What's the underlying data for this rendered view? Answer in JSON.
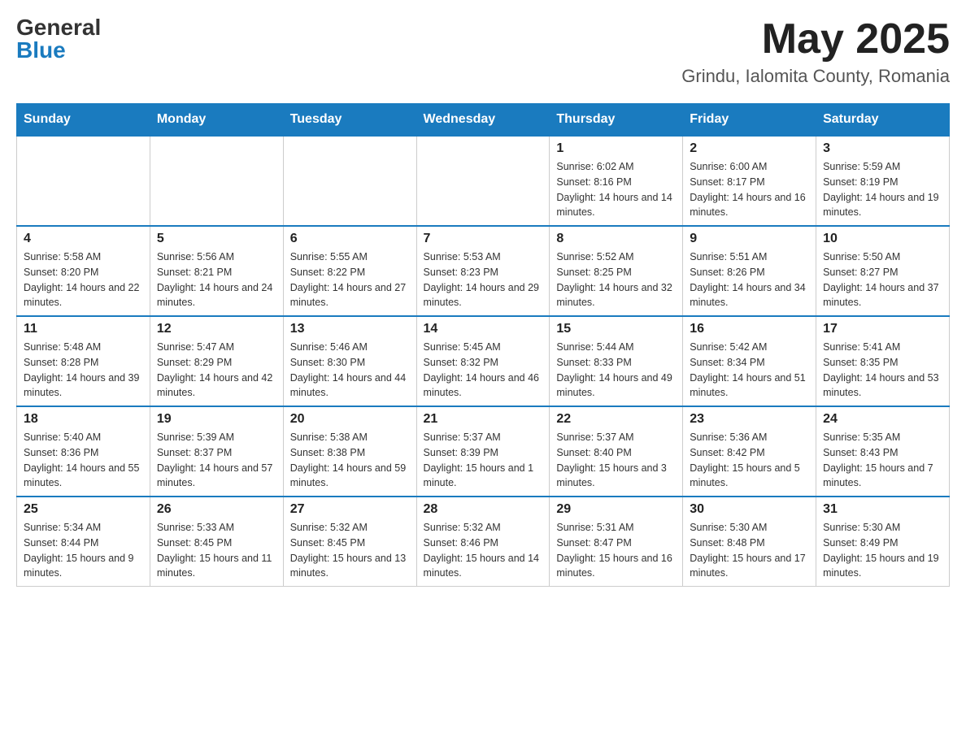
{
  "header": {
    "logo_general": "General",
    "logo_blue": "Blue",
    "month_title": "May 2025",
    "location": "Grindu, Ialomita County, Romania"
  },
  "weekdays": [
    "Sunday",
    "Monday",
    "Tuesday",
    "Wednesday",
    "Thursday",
    "Friday",
    "Saturday"
  ],
  "weeks": [
    [
      {
        "day": "",
        "info": ""
      },
      {
        "day": "",
        "info": ""
      },
      {
        "day": "",
        "info": ""
      },
      {
        "day": "",
        "info": ""
      },
      {
        "day": "1",
        "info": "Sunrise: 6:02 AM\nSunset: 8:16 PM\nDaylight: 14 hours and 14 minutes."
      },
      {
        "day": "2",
        "info": "Sunrise: 6:00 AM\nSunset: 8:17 PM\nDaylight: 14 hours and 16 minutes."
      },
      {
        "day": "3",
        "info": "Sunrise: 5:59 AM\nSunset: 8:19 PM\nDaylight: 14 hours and 19 minutes."
      }
    ],
    [
      {
        "day": "4",
        "info": "Sunrise: 5:58 AM\nSunset: 8:20 PM\nDaylight: 14 hours and 22 minutes."
      },
      {
        "day": "5",
        "info": "Sunrise: 5:56 AM\nSunset: 8:21 PM\nDaylight: 14 hours and 24 minutes."
      },
      {
        "day": "6",
        "info": "Sunrise: 5:55 AM\nSunset: 8:22 PM\nDaylight: 14 hours and 27 minutes."
      },
      {
        "day": "7",
        "info": "Sunrise: 5:53 AM\nSunset: 8:23 PM\nDaylight: 14 hours and 29 minutes."
      },
      {
        "day": "8",
        "info": "Sunrise: 5:52 AM\nSunset: 8:25 PM\nDaylight: 14 hours and 32 minutes."
      },
      {
        "day": "9",
        "info": "Sunrise: 5:51 AM\nSunset: 8:26 PM\nDaylight: 14 hours and 34 minutes."
      },
      {
        "day": "10",
        "info": "Sunrise: 5:50 AM\nSunset: 8:27 PM\nDaylight: 14 hours and 37 minutes."
      }
    ],
    [
      {
        "day": "11",
        "info": "Sunrise: 5:48 AM\nSunset: 8:28 PM\nDaylight: 14 hours and 39 minutes."
      },
      {
        "day": "12",
        "info": "Sunrise: 5:47 AM\nSunset: 8:29 PM\nDaylight: 14 hours and 42 minutes."
      },
      {
        "day": "13",
        "info": "Sunrise: 5:46 AM\nSunset: 8:30 PM\nDaylight: 14 hours and 44 minutes."
      },
      {
        "day": "14",
        "info": "Sunrise: 5:45 AM\nSunset: 8:32 PM\nDaylight: 14 hours and 46 minutes."
      },
      {
        "day": "15",
        "info": "Sunrise: 5:44 AM\nSunset: 8:33 PM\nDaylight: 14 hours and 49 minutes."
      },
      {
        "day": "16",
        "info": "Sunrise: 5:42 AM\nSunset: 8:34 PM\nDaylight: 14 hours and 51 minutes."
      },
      {
        "day": "17",
        "info": "Sunrise: 5:41 AM\nSunset: 8:35 PM\nDaylight: 14 hours and 53 minutes."
      }
    ],
    [
      {
        "day": "18",
        "info": "Sunrise: 5:40 AM\nSunset: 8:36 PM\nDaylight: 14 hours and 55 minutes."
      },
      {
        "day": "19",
        "info": "Sunrise: 5:39 AM\nSunset: 8:37 PM\nDaylight: 14 hours and 57 minutes."
      },
      {
        "day": "20",
        "info": "Sunrise: 5:38 AM\nSunset: 8:38 PM\nDaylight: 14 hours and 59 minutes."
      },
      {
        "day": "21",
        "info": "Sunrise: 5:37 AM\nSunset: 8:39 PM\nDaylight: 15 hours and 1 minute."
      },
      {
        "day": "22",
        "info": "Sunrise: 5:37 AM\nSunset: 8:40 PM\nDaylight: 15 hours and 3 minutes."
      },
      {
        "day": "23",
        "info": "Sunrise: 5:36 AM\nSunset: 8:42 PM\nDaylight: 15 hours and 5 minutes."
      },
      {
        "day": "24",
        "info": "Sunrise: 5:35 AM\nSunset: 8:43 PM\nDaylight: 15 hours and 7 minutes."
      }
    ],
    [
      {
        "day": "25",
        "info": "Sunrise: 5:34 AM\nSunset: 8:44 PM\nDaylight: 15 hours and 9 minutes."
      },
      {
        "day": "26",
        "info": "Sunrise: 5:33 AM\nSunset: 8:45 PM\nDaylight: 15 hours and 11 minutes."
      },
      {
        "day": "27",
        "info": "Sunrise: 5:32 AM\nSunset: 8:45 PM\nDaylight: 15 hours and 13 minutes."
      },
      {
        "day": "28",
        "info": "Sunrise: 5:32 AM\nSunset: 8:46 PM\nDaylight: 15 hours and 14 minutes."
      },
      {
        "day": "29",
        "info": "Sunrise: 5:31 AM\nSunset: 8:47 PM\nDaylight: 15 hours and 16 minutes."
      },
      {
        "day": "30",
        "info": "Sunrise: 5:30 AM\nSunset: 8:48 PM\nDaylight: 15 hours and 17 minutes."
      },
      {
        "day": "31",
        "info": "Sunrise: 5:30 AM\nSunset: 8:49 PM\nDaylight: 15 hours and 19 minutes."
      }
    ]
  ]
}
